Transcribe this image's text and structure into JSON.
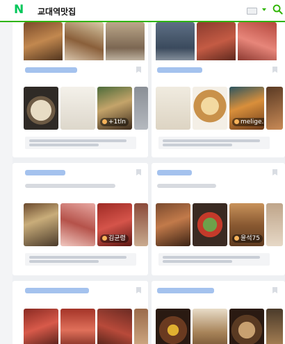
{
  "header": {
    "query": "교대역맛집",
    "logo_text": "N"
  },
  "thumb_tags": [
    "+1tln",
    "melige..",
    "김균령",
    "윤석75"
  ],
  "colors": {
    "brand": "#03c75a",
    "link": "#3b7be0",
    "bar": "#2db400"
  }
}
